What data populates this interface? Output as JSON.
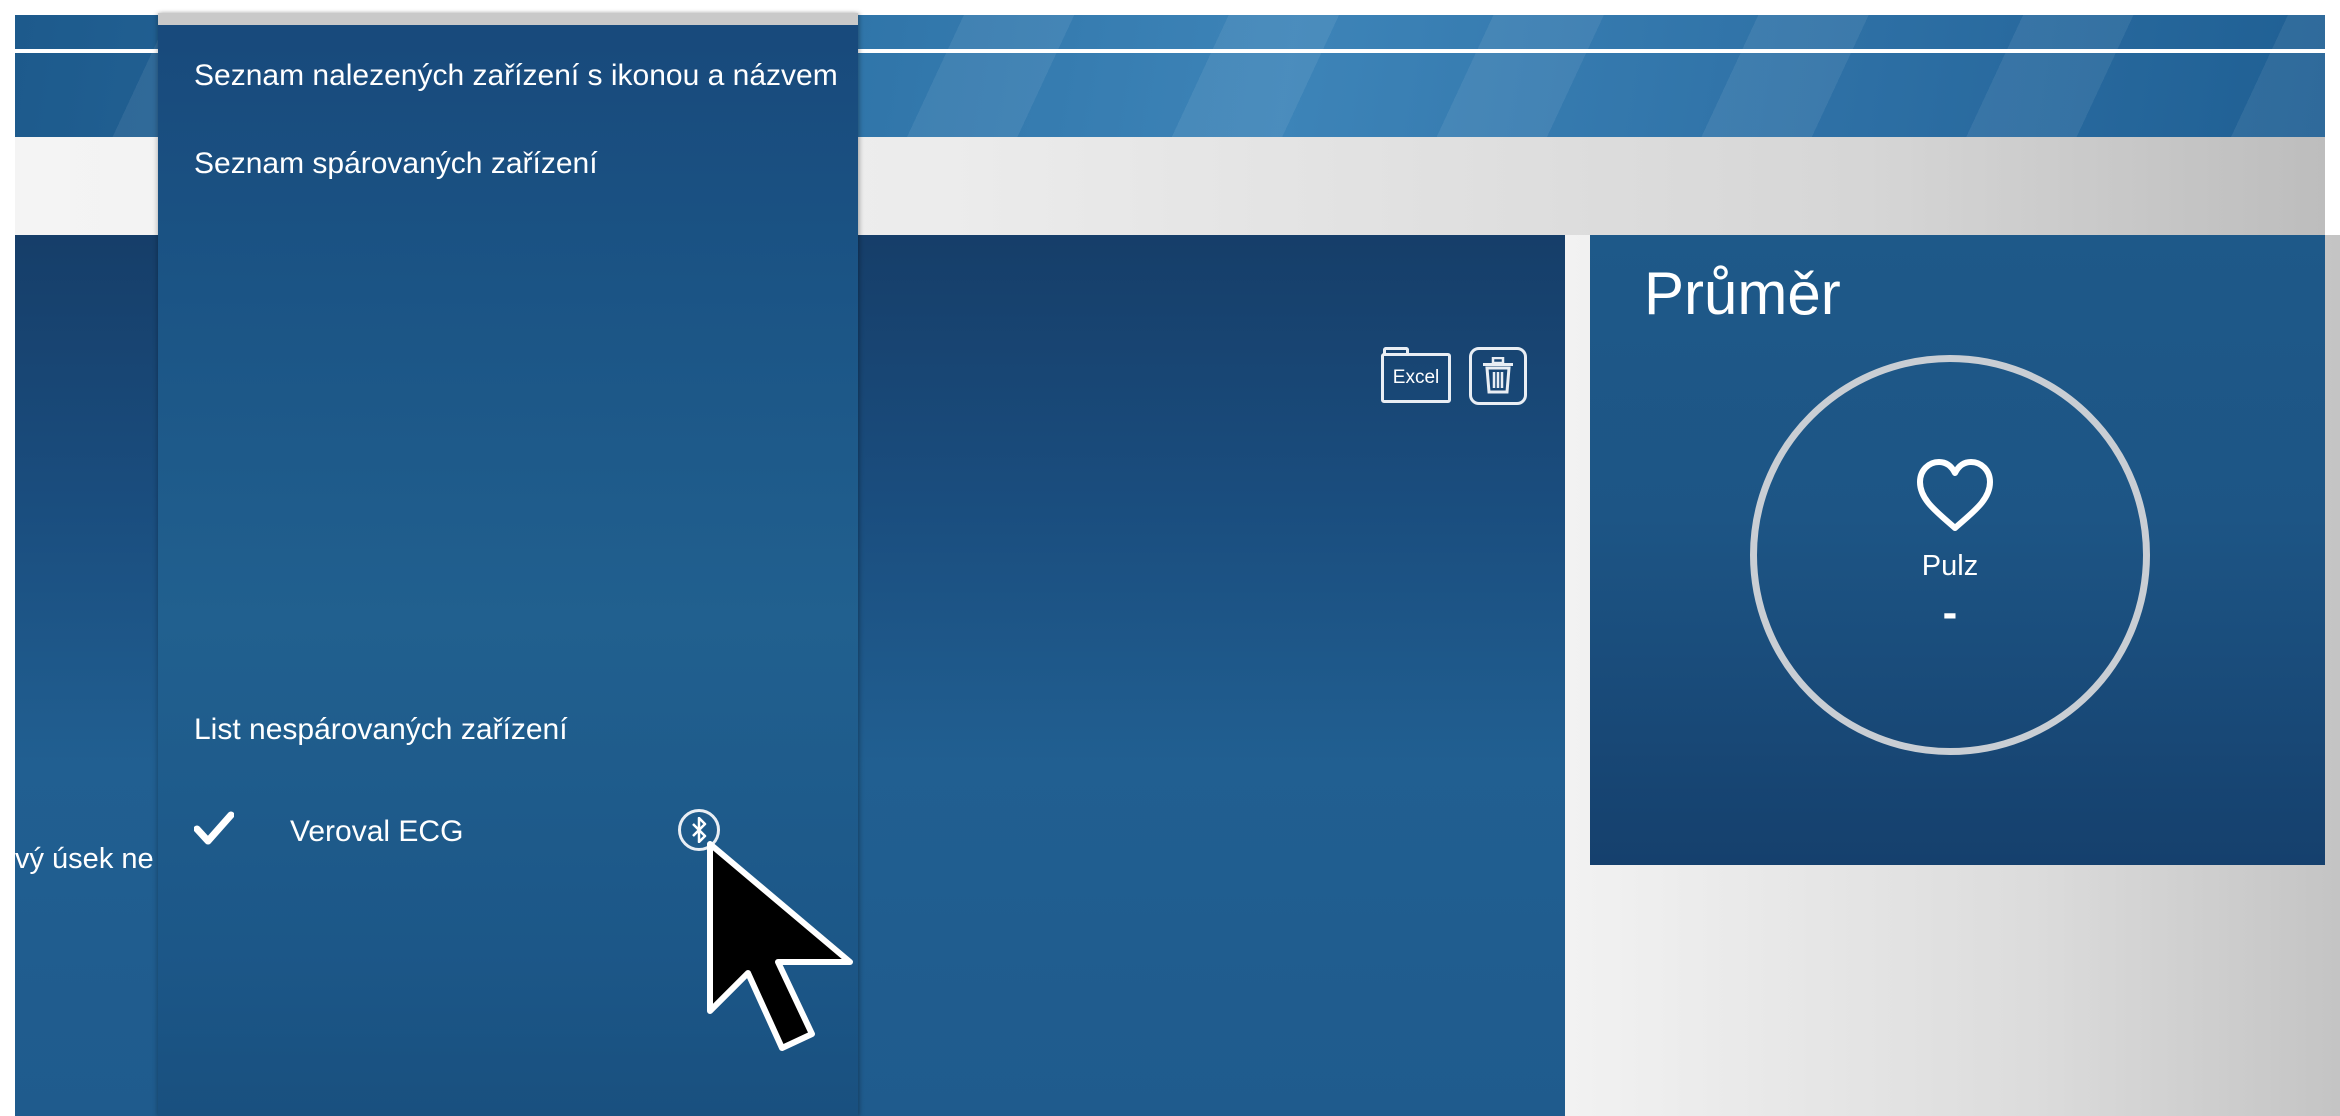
{
  "colors": {
    "panel_blue": "#1d5585",
    "banner_blue": "#2f74a8",
    "text": "#ffffff",
    "ring": "#c9ced4"
  },
  "toolbar": {
    "excel_label": "Excel",
    "excel_icon": "excel-folder-icon",
    "delete_icon": "trash-icon"
  },
  "main": {
    "cut_text": "vý úsek ne"
  },
  "average": {
    "title": "Průměr",
    "pulse_label": "Pulz",
    "pulse_value": "-",
    "icon": "heart-icon"
  },
  "flyout": {
    "found_devices_label": "Seznam nalezených zařízení s ikonou a názvem",
    "paired_devices_label": "Seznam spárovaných zařízení",
    "unpaired_devices_label": "List nespárovaných zařízení",
    "devices": [
      {
        "name": "Veroval ECG",
        "status_icon": "check-icon",
        "action_icon": "bluetooth-icon"
      }
    ]
  }
}
